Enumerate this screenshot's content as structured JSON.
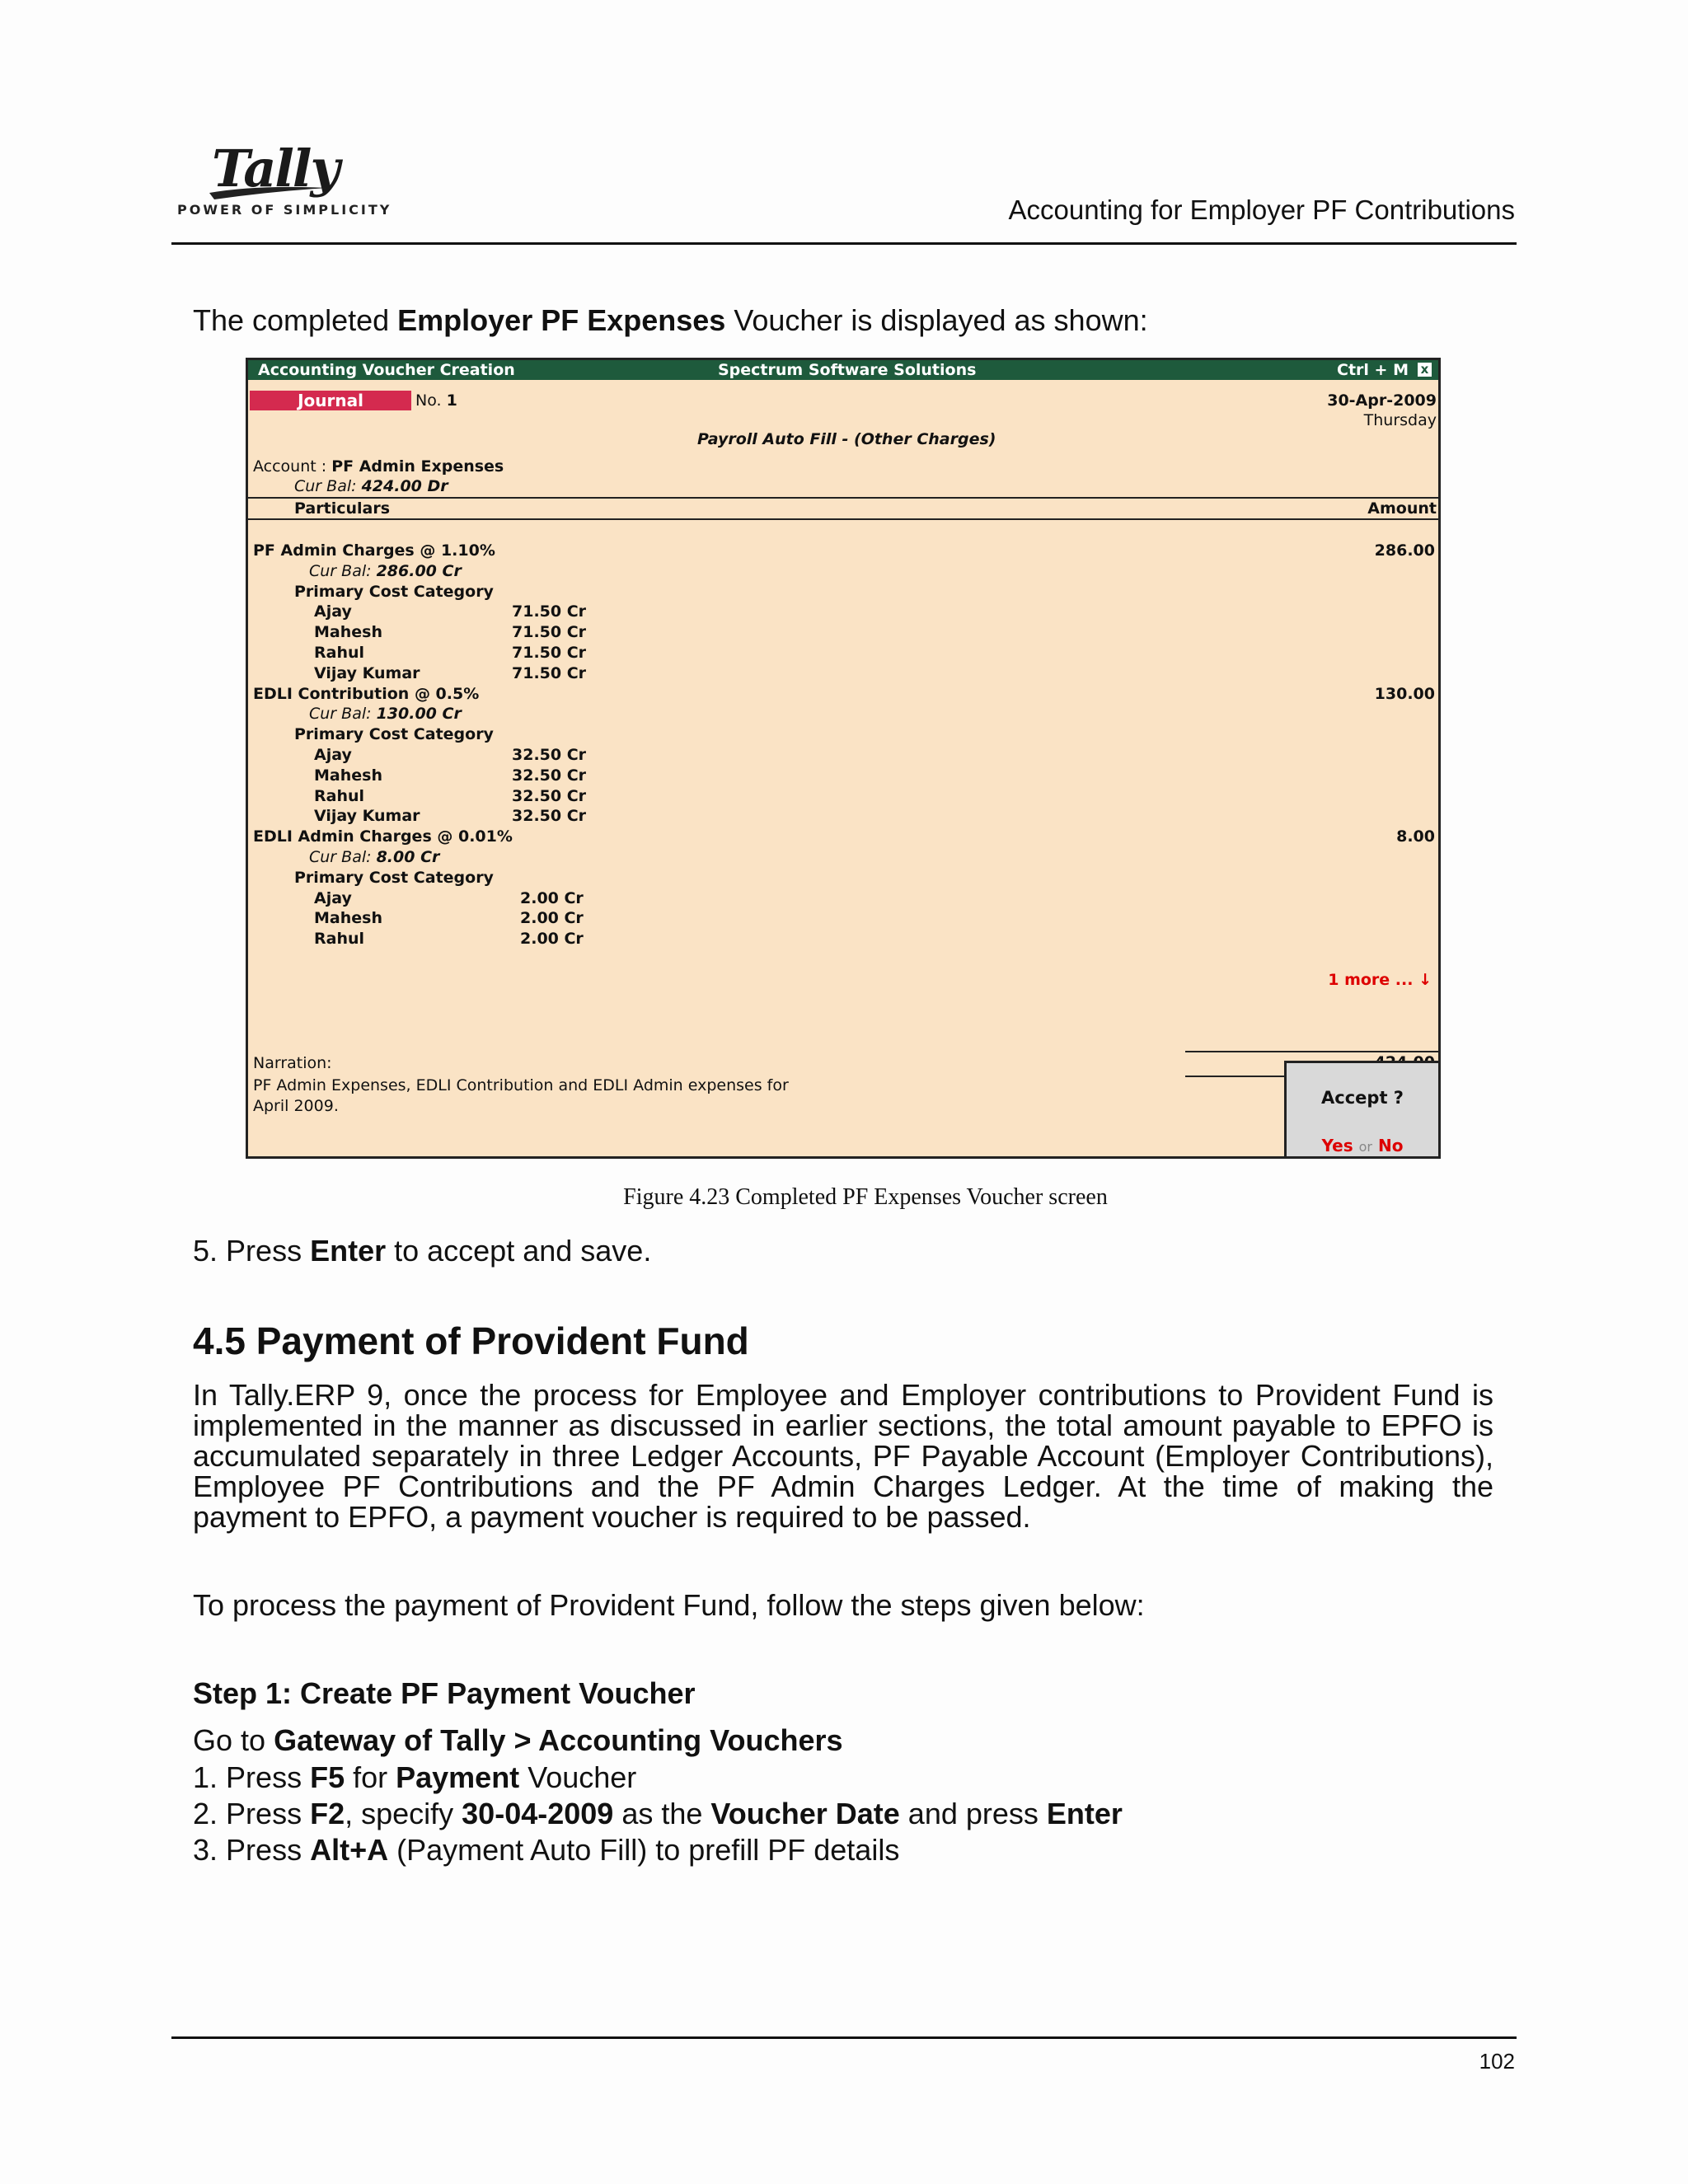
{
  "header": {
    "logo_text": "Tally",
    "logo_tagline": "POWER OF SIMPLICITY",
    "title": "Accounting for Employer PF Contributions"
  },
  "intro": {
    "pre": "The completed ",
    "bold": "Employer PF Expenses",
    "post": " Voucher is displayed as shown:"
  },
  "screen": {
    "title_left": "Accounting Voucher  Creation",
    "title_mid": "Spectrum Software Solutions",
    "title_right": "Ctrl + M",
    "close_icon": "x",
    "voucher_type": "Journal",
    "no_label": "No.",
    "no_value": "1",
    "date": "30-Apr-2009",
    "day": "Thursday",
    "subtitle": "Payroll Auto Fill - (Other Charges)",
    "account_label": "Account :",
    "account_value": "PF Admin Expenses",
    "account_curbal_label": "Cur Bal:",
    "account_curbal_value": "424.00 Dr",
    "col_particulars": "Particulars",
    "col_amount": "Amount",
    "entries": [
      {
        "ledger": "PF Admin Charges @ 1.10%",
        "curbal_label": "Cur Bal:",
        "curbal": "286.00 Cr",
        "category": "Primary Cost Category",
        "amount": "286.00",
        "items": [
          {
            "name": "Ajay",
            "value": "71.50 Cr"
          },
          {
            "name": "Mahesh",
            "value": "71.50 Cr"
          },
          {
            "name": "Rahul",
            "value": "71.50 Cr"
          },
          {
            "name": "Vijay Kumar",
            "value": "71.50 Cr"
          }
        ]
      },
      {
        "ledger": "EDLI Contribution @ 0.5%",
        "curbal_label": "Cur Bal:",
        "curbal": "130.00 Cr",
        "category": "Primary Cost Category",
        "amount": "130.00",
        "items": [
          {
            "name": "Ajay",
            "value": "32.50 Cr"
          },
          {
            "name": "Mahesh",
            "value": "32.50 Cr"
          },
          {
            "name": "Rahul",
            "value": "32.50 Cr"
          },
          {
            "name": "Vijay Kumar",
            "value": "32.50 Cr"
          }
        ]
      },
      {
        "ledger": "EDLI Admin Charges @ 0.01%",
        "curbal_label": "Cur Bal:",
        "curbal": "8.00 Cr",
        "category": "Primary Cost Category",
        "amount": "8.00",
        "items": [
          {
            "name": "Ajay",
            "value": "2.00 Cr"
          },
          {
            "name": "Mahesh",
            "value": "2.00 Cr"
          },
          {
            "name": "Rahul",
            "value": "2.00 Cr"
          }
        ]
      }
    ],
    "more": "1 more ... ↓",
    "narration_label": "Narration:",
    "narration_line1": "PF Admin Expenses, EDLI Contribution and EDLI Admin expenses for",
    "narration_line2": "April 2009.",
    "total": "424.00",
    "accept_label": "Accept ?",
    "yes": "Yes",
    "or": "or",
    "no": "No"
  },
  "caption": "Figure 4.23  Completed PF Expenses Voucher screen",
  "step5": {
    "num": "5.",
    "pre": "Press ",
    "bold": "Enter",
    "post": " to accept and save."
  },
  "section_title": "4.5  Payment of Provident Fund",
  "body_lines": [
    "In Tally.ERP 9, once the process for Employee and Employer contributions to Provident Fund is",
    "implemented in the manner as discussed in earlier sections, the total amount payable to EPFO is",
    "accumulated separately in three Ledger Accounts, PF Payable Account (Employer Contributions),",
    "Employee PF Contributions and the PF Admin Charges Ledger. At the time of making the",
    "payment to EPFO, a payment voucher is required to be passed."
  ],
  "process_intro": "To process the payment of Provident Fund, follow the steps given below:",
  "step1_heading": "Step 1: Create PF Payment Voucher",
  "goto": {
    "pre": "Go to ",
    "bold": "Gateway of Tally > Accounting Vouchers"
  },
  "steps": [
    {
      "num": "1.",
      "parts": [
        [
          "Press ",
          false
        ],
        [
          "F5",
          true
        ],
        [
          " for ",
          false
        ],
        [
          "Payment",
          true
        ],
        [
          " Voucher",
          false
        ]
      ]
    },
    {
      "num": "2.",
      "parts": [
        [
          "Press ",
          false
        ],
        [
          "F2",
          true
        ],
        [
          ", specify ",
          false
        ],
        [
          "30-04-2009",
          true
        ],
        [
          " as the ",
          false
        ],
        [
          "Voucher Date",
          true
        ],
        [
          " and press ",
          false
        ],
        [
          "Enter",
          true
        ]
      ]
    },
    {
      "num": "3.",
      "parts": [
        [
          "Press ",
          false
        ],
        [
          "Alt+A",
          true
        ],
        [
          " (Payment Auto Fill) to prefill PF details",
          false
        ]
      ]
    }
  ],
  "page_number": "102"
}
